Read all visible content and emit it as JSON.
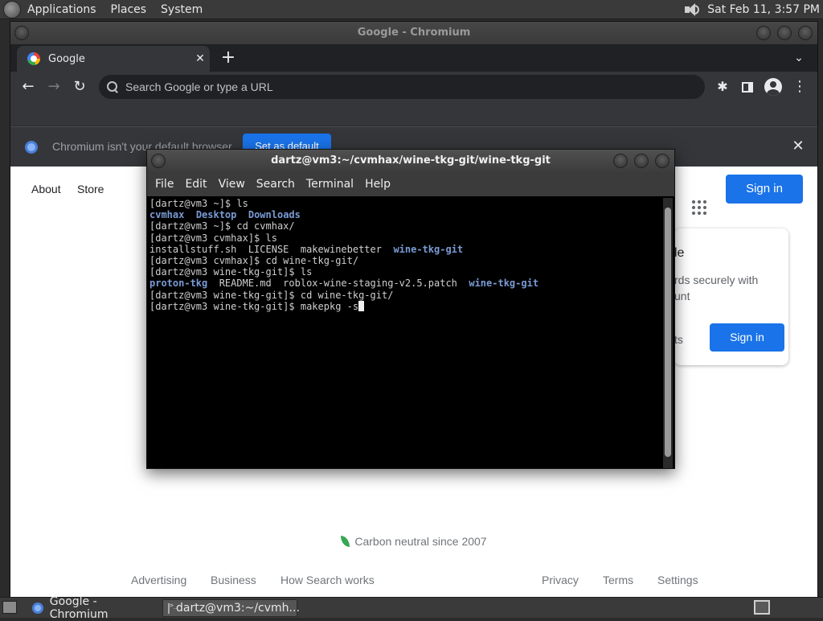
{
  "top_panel": {
    "menus": [
      "Applications",
      "Places",
      "System"
    ],
    "clock": "Sat Feb 11,  3:57 PM"
  },
  "chromium": {
    "window_title": "Google - Chromium",
    "tab_title": "Google",
    "omnibox_placeholder": "Search Google or type a URL",
    "infobar_text": "Chromium isn't your default browser",
    "set_default_label": "Set as default"
  },
  "google_page": {
    "nav_links": [
      "About",
      "Store"
    ],
    "signin_label": "Sign in",
    "card": {
      "title_fragment": "le",
      "body_fragment": "rds securely with\nunt",
      "side_fragment": "ts",
      "signin_label": "Sign in"
    },
    "carbon_text": "Carbon neutral since 2007",
    "footer_left": [
      "Advertising",
      "Business",
      "How Search works"
    ],
    "footer_right": [
      "Privacy",
      "Terms",
      "Settings"
    ]
  },
  "terminal": {
    "window_title": "dartz@vm3:~/cvmhax/wine-tkg-git/wine-tkg-git",
    "menus": [
      "File",
      "Edit",
      "View",
      "Search",
      "Terminal",
      "Help"
    ],
    "lines": [
      [
        {
          "t": "[dartz@vm3 ~]$ ls"
        }
      ],
      [
        {
          "t": "cvmhax",
          "dir": true
        },
        {
          "t": "  "
        },
        {
          "t": "Desktop",
          "dir": true
        },
        {
          "t": "  "
        },
        {
          "t": "Downloads",
          "dir": true
        }
      ],
      [
        {
          "t": "[dartz@vm3 ~]$ cd cvmhax/"
        }
      ],
      [
        {
          "t": "[dartz@vm3 cvmhax]$ ls"
        }
      ],
      [
        {
          "t": "installstuff.sh  LICENSE  makewinebetter  "
        },
        {
          "t": "wine-tkg-git",
          "dir": true
        }
      ],
      [
        {
          "t": "[dartz@vm3 cvmhax]$ cd wine-tkg-git/"
        }
      ],
      [
        {
          "t": "[dartz@vm3 wine-tkg-git]$ ls"
        }
      ],
      [
        {
          "t": "proton-tkg",
          "dir": true
        },
        {
          "t": "  README.md  roblox-wine-staging-v2.5.patch  "
        },
        {
          "t": "wine-tkg-git",
          "dir": true
        }
      ],
      [
        {
          "t": "[dartz@vm3 wine-tkg-git]$ cd wine-tkg-git/"
        }
      ],
      [
        {
          "t": "[dartz@vm3 wine-tkg-git]$ makepkg -s"
        },
        {
          "cursor": true
        }
      ]
    ]
  },
  "taskbar": {
    "tasks": [
      "Google - Chromium",
      "dartz@vm3:~/cvmh..."
    ]
  },
  "colors": {
    "google_blue": "#1a73e8",
    "terminal_dir": "#7a9bd6",
    "chrome_dark": "#35363a"
  }
}
